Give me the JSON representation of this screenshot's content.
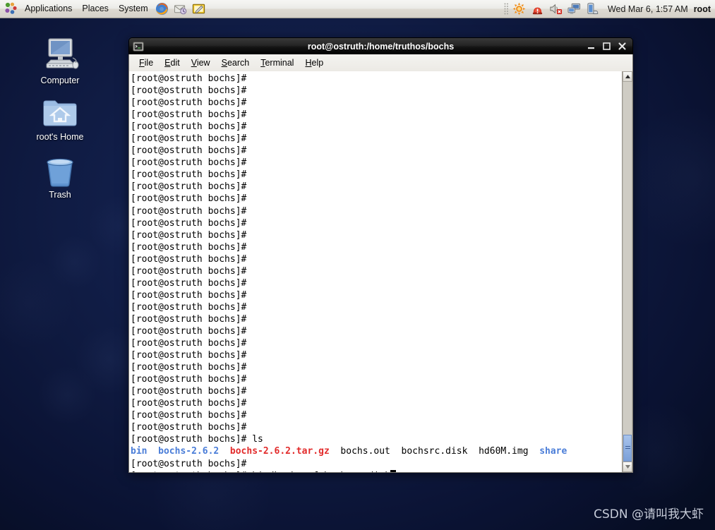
{
  "panel": {
    "logo_icon": "gnome-foot-icon",
    "menus": [
      {
        "label": "Applications",
        "name": "applications-menu"
      },
      {
        "label": "Places",
        "name": "places-menu"
      },
      {
        "label": "System",
        "name": "system-menu"
      }
    ],
    "launchers": [
      {
        "icon": "firefox-icon",
        "name": "launcher-firefox"
      },
      {
        "icon": "evolution-mail-icon",
        "name": "launcher-evolution"
      },
      {
        "icon": "text-editor-icon",
        "name": "launcher-gedit"
      }
    ],
    "tray": [
      {
        "icon": "software-update-icon",
        "name": "tray-software-update"
      },
      {
        "icon": "alert-icon",
        "name": "tray-alert"
      },
      {
        "icon": "volume-muted-icon",
        "name": "tray-volume-muted"
      },
      {
        "icon": "network-icon",
        "name": "tray-network"
      },
      {
        "icon": "battery-icon",
        "name": "tray-battery"
      }
    ],
    "clock": "Wed Mar  6,  1:57 AM",
    "user": "root"
  },
  "desktop": {
    "icons": [
      {
        "label": "Computer",
        "icon": "computer-icon",
        "name": "desktop-icon-computer"
      },
      {
        "label": "root's Home",
        "icon": "home-folder-icon",
        "name": "desktop-icon-home"
      },
      {
        "label": "Trash",
        "icon": "trash-icon",
        "name": "desktop-icon-trash"
      }
    ]
  },
  "terminal": {
    "title": "root@ostruth:/home/truthos/bochs",
    "icon": "terminal-icon",
    "window_buttons": [
      {
        "label": "minimize",
        "name": "minimize-button"
      },
      {
        "label": "maximize",
        "name": "maximize-button"
      },
      {
        "label": "close",
        "name": "close-button"
      }
    ],
    "menus": [
      {
        "label": "File",
        "accel": "F",
        "name": "menu-file"
      },
      {
        "label": "Edit",
        "accel": "E",
        "name": "menu-edit"
      },
      {
        "label": "View",
        "accel": "V",
        "name": "menu-view"
      },
      {
        "label": "Search",
        "accel": "S",
        "name": "menu-search"
      },
      {
        "label": "Terminal",
        "accel": "T",
        "name": "menu-terminal"
      },
      {
        "label": "Help",
        "accel": "H",
        "name": "menu-help"
      }
    ],
    "prompt": "[root@ostruth bochs]#",
    "blank_prompt_count": 30,
    "ls_command": " ls",
    "ls_output": [
      {
        "text": "bin",
        "color": "blue"
      },
      {
        "text": "  ",
        "color": "black"
      },
      {
        "text": "bochs-2.6.2",
        "color": "blue"
      },
      {
        "text": "  ",
        "color": "black"
      },
      {
        "text": "bochs-2.6.2.tar.gz",
        "color": "red"
      },
      {
        "text": "  bochs.out  bochsrc.disk  hd60M.img  ",
        "color": "black"
      },
      {
        "text": "share",
        "color": "blue"
      }
    ],
    "final_command": " bin/bochs -f bochsrc.disk",
    "colors": {
      "directory": "#4a7dd8",
      "archive": "#e22b2b",
      "foreground": "#000000",
      "background": "#ffffff"
    },
    "scrollbar": {
      "position": "bottom"
    }
  },
  "watermark": "CSDN @请叫我大虾"
}
